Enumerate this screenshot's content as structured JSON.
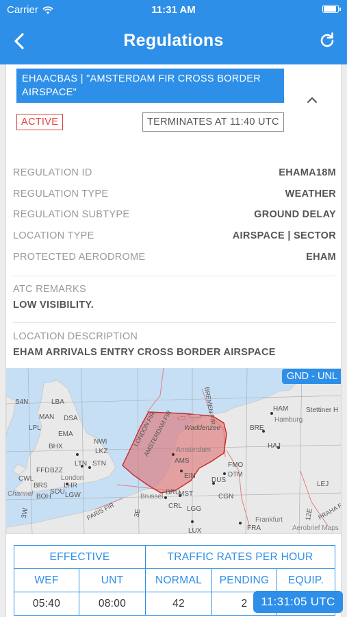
{
  "status_bar": {
    "carrier": "Carrier",
    "time": "11:31 AM"
  },
  "nav": {
    "title": "Regulations"
  },
  "regulation": {
    "banner": "EHAACBAS  |  \"AMSTERDAM FIR CROSS BORDER AIRSPACE\"",
    "status": "ACTIVE",
    "terminates": "TERMINATES AT 11:40 UTC",
    "fields": [
      {
        "key": "REGULATION ID",
        "value": "EHAMA18M"
      },
      {
        "key": "REGULATION TYPE",
        "value": "WEATHER"
      },
      {
        "key": "REGULATION SUBTYPE",
        "value": "GROUND DELAY"
      },
      {
        "key": "LOCATION TYPE",
        "value": "AIRSPACE | SECTOR"
      },
      {
        "key": "PROTECTED AERODROME",
        "value": "EHAM"
      }
    ],
    "atc_remarks_label": "ATC REMARKS",
    "atc_remarks": "LOW VISIBILITY.",
    "location_description_label": "LOCATION DESCRIPTION",
    "location_description": "EHAM ARRIVALS ENTRY CROSS BORDER AIRSPACE"
  },
  "map": {
    "altitude_band": "GND - UNL",
    "attribution": "Aerobrief Maps",
    "labels": {
      "lat_54": "54N",
      "lon_3w": "3W",
      "lon_3e": "3E",
      "lon_12e": "12E",
      "london_fir": "LONDON FIR",
      "amsterdam_fir": "AMSTERDAM FIR",
      "bremen_fir": "BREMEN FIR",
      "paris_fir": "PARIS FIR",
      "praha_fir": "PRAHA F",
      "waddenzee": "Waddenzee",
      "amsterdam_city": "Amsterdam",
      "london_city": "London",
      "brussels_city": "Brussel",
      "hamburg_city": "Hamburg",
      "stettiner": "Stettiner H",
      "channel": "Channel",
      "frankfurt": "Frankfurt"
    },
    "airports": [
      "LBA",
      "MAN",
      "DSA",
      "LPL",
      "EMA",
      "BHX",
      "NWI",
      "LKZ",
      "LTN",
      "STN",
      "FFD",
      "BZZ",
      "CWL",
      "BRS",
      "LHR",
      "SOU",
      "BOH",
      "LGW",
      "AMS",
      "EIN",
      "BRU",
      "MST",
      "CRL",
      "LGG",
      "DUS",
      "DTM",
      "FMO",
      "CGN",
      "HAM",
      "BRE",
      "HAJ",
      "LEJ",
      "FRA",
      "LUX"
    ],
    "colors": {
      "water": "#c6dff5",
      "land": "#e9e9e9",
      "area_fill": "#e07070",
      "area_stroke": "#c62828"
    }
  },
  "rates": {
    "effective_header": "EFFECTIVE",
    "traffic_header": "TRAFFIC RATES PER HOUR",
    "columns": [
      "WEF",
      "UNT",
      "NORMAL",
      "PENDING",
      "EQUIP."
    ],
    "row": [
      "05:40",
      "08:00",
      "42",
      "2",
      ""
    ]
  },
  "clock": "11:31:05 UTC",
  "colors": {
    "accent": "#2e8fe8",
    "active": "#e0403a"
  }
}
